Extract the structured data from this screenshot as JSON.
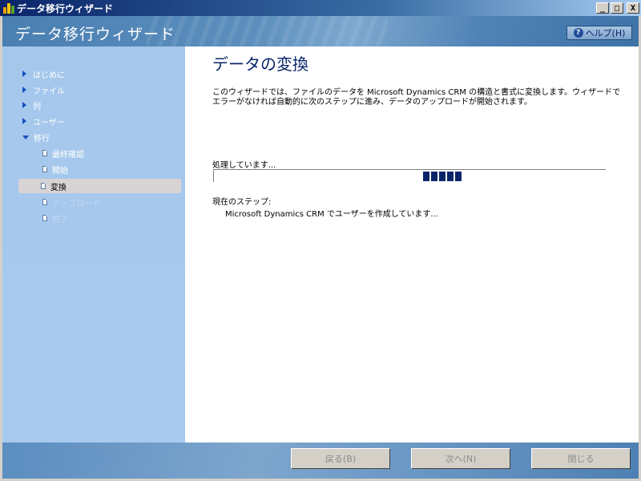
{
  "window": {
    "title": "データ移行ウィザード",
    "minimize": "_",
    "maximize": "□",
    "close": "X"
  },
  "header": {
    "title": "データ移行ウィザード",
    "help_label": "ヘルプ(H)",
    "help_icon": "?"
  },
  "sidebar": {
    "items": [
      {
        "label": "はじめに"
      },
      {
        "label": "ファイル"
      },
      {
        "label": "列"
      },
      {
        "label": "ユーザー"
      },
      {
        "label": "移行"
      },
      {
        "label": "最終確認"
      },
      {
        "label": "開始"
      },
      {
        "label": "変換"
      },
      {
        "label": "アップロード"
      },
      {
        "label": "完了"
      }
    ],
    "selected": "変換"
  },
  "main": {
    "title": "データの変換",
    "description": "このウィザードでは、ファイルのデータを Microsoft Dynamics CRM の構造と書式に変換します。ウィザードでエラーがなければ自動的に次のステップに進み、データのアップロードが開始されます。",
    "processing_label": "処理しています...",
    "current_step_label": "現在のステップ:",
    "current_step": "Microsoft Dynamics CRM でユーザーを作成しています..."
  },
  "footer": {
    "back_label": "戻る(B)",
    "next_label": "次へ(N)",
    "close_label": "閉じる"
  }
}
